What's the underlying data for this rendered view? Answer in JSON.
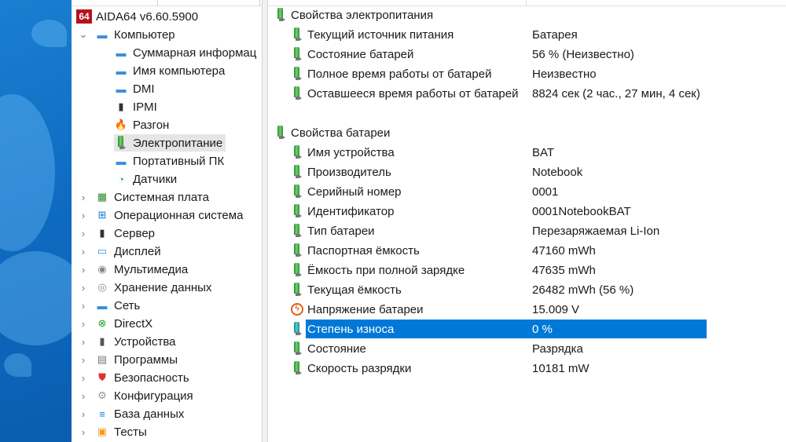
{
  "app": {
    "title": "AIDA64 v6.60.5900",
    "logo": "64"
  },
  "tree": [
    {
      "label": "Компьютер",
      "level": 0,
      "expanded": true,
      "icon": "computer-icon"
    },
    {
      "label": "Суммарная информац",
      "level": 1,
      "icon": "computer-icon"
    },
    {
      "label": "Имя компьютера",
      "level": 1,
      "icon": "computer-icon"
    },
    {
      "label": "DMI",
      "level": 1,
      "icon": "computer-icon"
    },
    {
      "label": "IPMI",
      "level": 1,
      "icon": "server-icon"
    },
    {
      "label": "Разгон",
      "level": 1,
      "icon": "flame-icon"
    },
    {
      "label": "Электропитание",
      "level": 1,
      "icon": "battery-icon",
      "selected": true
    },
    {
      "label": "Портативный ПК",
      "level": 1,
      "icon": "laptop-icon"
    },
    {
      "label": "Датчики",
      "level": 1,
      "icon": "gauge-icon"
    },
    {
      "label": "Системная плата",
      "level": 0,
      "icon": "motherboard-icon"
    },
    {
      "label": "Операционная система",
      "level": 0,
      "icon": "windows-icon"
    },
    {
      "label": "Сервер",
      "level": 0,
      "icon": "server-icon"
    },
    {
      "label": "Дисплей",
      "level": 0,
      "icon": "monitor-icon"
    },
    {
      "label": "Мультимедиа",
      "level": 0,
      "icon": "speaker-icon"
    },
    {
      "label": "Хранение данных",
      "level": 0,
      "icon": "disk-icon"
    },
    {
      "label": "Сеть",
      "level": 0,
      "icon": "network-icon"
    },
    {
      "label": "DirectX",
      "level": 0,
      "icon": "xbox-icon"
    },
    {
      "label": "Устройства",
      "level": 0,
      "icon": "device-icon"
    },
    {
      "label": "Программы",
      "level": 0,
      "icon": "programs-icon"
    },
    {
      "label": "Безопасность",
      "level": 0,
      "icon": "shield-icon"
    },
    {
      "label": "Конфигурация",
      "level": 0,
      "icon": "config-icon"
    },
    {
      "label": "База данных",
      "level": 0,
      "icon": "database-icon"
    },
    {
      "label": "Тесты",
      "level": 0,
      "icon": "tests-icon"
    }
  ],
  "sections": [
    {
      "title": "Свойства электропитания",
      "rows": [
        {
          "label": "Текущий источник питания",
          "value": "Батарея"
        },
        {
          "label": "Состояние батарей",
          "value": "56 % (Неизвестно)"
        },
        {
          "label": "Полное время работы от батарей",
          "value": "Неизвестно"
        },
        {
          "label": "Оставшееся время работы от батарей",
          "value": "8824 сек (2 час., 27 мин, 4 сек)"
        }
      ]
    },
    {
      "title": "Свойства батареи",
      "rows": [
        {
          "label": "Имя устройства",
          "value": "BAT"
        },
        {
          "label": "Производитель",
          "value": "Notebook"
        },
        {
          "label": "Серийный номер",
          "value": "0001"
        },
        {
          "label": "Идентификатор",
          "value": "0001NotebookBAT"
        },
        {
          "label": "Тип батареи",
          "value": "Перезаряжаемая Li-Ion"
        },
        {
          "label": "Паспортная ёмкость",
          "value": "47160 mWh"
        },
        {
          "label": "Ёмкость при полной зарядке",
          "value": "47635 mWh"
        },
        {
          "label": "Текущая ёмкость",
          "value": "26482 mWh  (56 %)"
        },
        {
          "label": "Напряжение батареи",
          "value": "15.009 V",
          "icon": "voltage-icon"
        },
        {
          "label": "Степень износа",
          "value": "0 %",
          "selected": true
        },
        {
          "label": "Состояние",
          "value": "Разрядка"
        },
        {
          "label": "Скорость разрядки",
          "value": "10181 mW"
        }
      ]
    }
  ],
  "colors": {
    "selection": "#0078d7",
    "logo": "#b5121b"
  }
}
